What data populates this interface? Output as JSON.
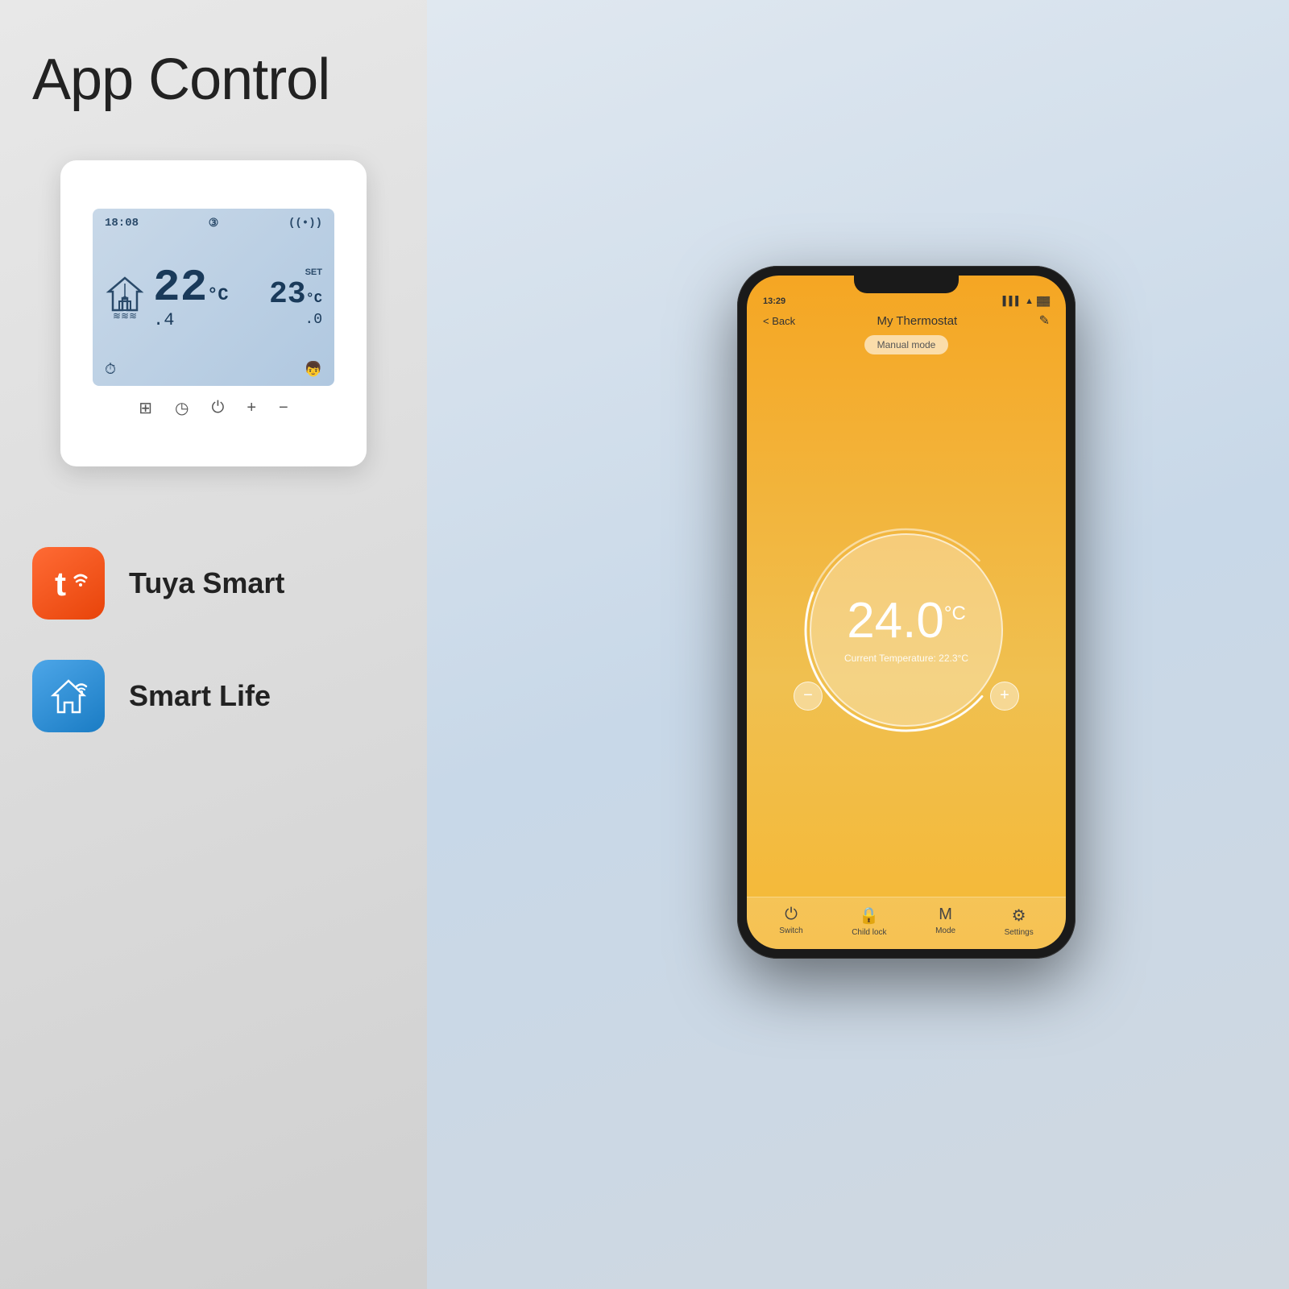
{
  "left_panel": {
    "title_line1": "App Control",
    "thermostat": {
      "time": "18:08",
      "program_num": "3",
      "wifi_icon": "📶",
      "main_temp": "22°C",
      "main_temp_decimal": ".4",
      "set_label": "SET",
      "set_temp": "23°C",
      "set_temp_decimal": ".0",
      "flame_icon": "🔥",
      "clock_icon": "⏱",
      "child_icon": "👶"
    },
    "buttons": [
      "⊞",
      "◷",
      "⏻",
      "+",
      "−"
    ],
    "brands": [
      {
        "name": "Tuya Smart",
        "logo_text": "t",
        "logo_type": "tuya"
      },
      {
        "name": "Smart Life",
        "logo_text": "⌂",
        "logo_type": "smartlife"
      }
    ]
  },
  "right_panel": {
    "phone": {
      "status_bar": {
        "time": "13:29",
        "signal": "▌▌▌",
        "wifi": "▲",
        "battery": "▓▓▓"
      },
      "header": {
        "back_label": "< Back",
        "title": "My Thermostat",
        "edit_icon": "✎"
      },
      "mode_badge": "Manual mode",
      "temperature": {
        "value": "24.0",
        "unit": "°C",
        "current_label": "Current Temperature: 22.3°C"
      },
      "minus_btn": "−",
      "plus_btn": "+",
      "nav_items": [
        {
          "icon": "⏻",
          "label": "Switch"
        },
        {
          "icon": "🔒",
          "label": "Child lock"
        },
        {
          "icon": "M",
          "label": "Mode"
        },
        {
          "icon": "⚙",
          "label": "Settings"
        }
      ]
    }
  }
}
